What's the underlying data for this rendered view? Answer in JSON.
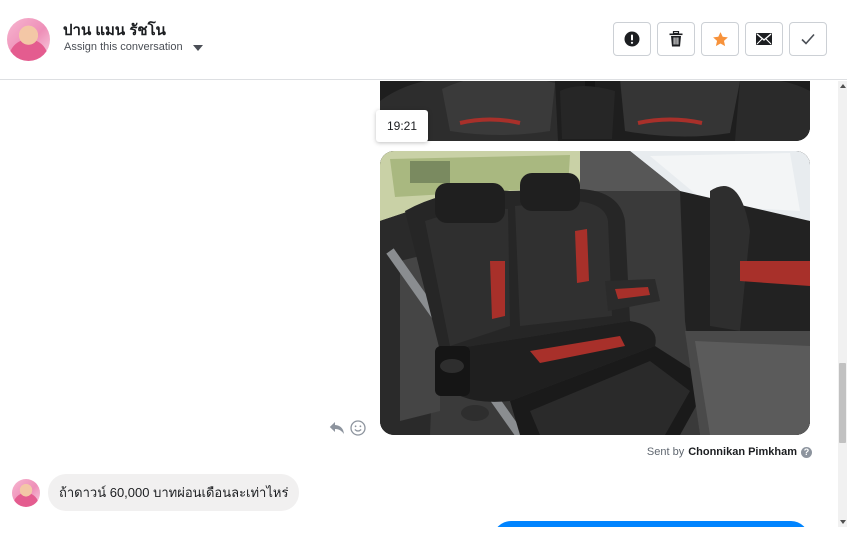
{
  "header": {
    "contact_name": "ปาน แมน รัชโน",
    "assign_label": "Assign this conversation"
  },
  "actions": [
    {
      "name": "spam-button",
      "icon": "exclamation-icon"
    },
    {
      "name": "delete-button",
      "icon": "trash-icon"
    },
    {
      "name": "star-button",
      "icon": "star-icon",
      "color": "#f7923b"
    },
    {
      "name": "mark-unread-button",
      "icon": "envelope-icon"
    },
    {
      "name": "mark-done-button",
      "icon": "checkmark-icon"
    }
  ],
  "thread": {
    "timestamp": "19:21",
    "sent_by_prefix": "Sent by",
    "sent_by_name": "Chonnikan Pimkham",
    "incoming_message": "ถ้าดาวน์ 60,000 บาทผ่อนเดือนละเท่าไหร่",
    "outgoing_color": "#0084ff"
  }
}
